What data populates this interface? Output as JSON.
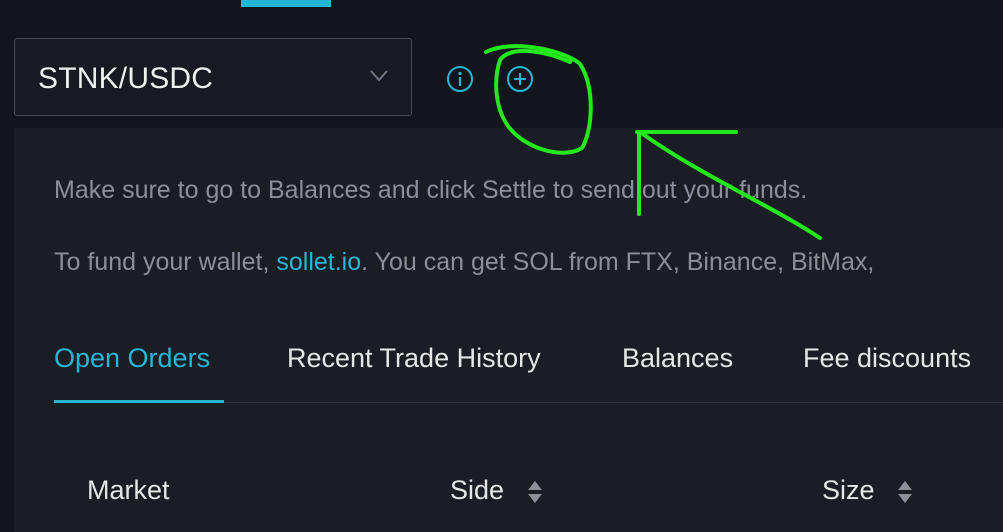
{
  "market": {
    "selected": "STNK/USDC"
  },
  "icons": {
    "info": "info-icon",
    "add_market": "add-market-icon",
    "dropdown": "chevron-down-icon",
    "sort": "sort-icon"
  },
  "notices": {
    "settle": "Make sure to go to Balances and click Settle to send out your funds.",
    "fund_prefix": "To fund your wallet,",
    "fund_link": "sollet.io",
    "fund_suffix": ". You can get SOL from FTX, Binance, BitMax,"
  },
  "tabs": [
    {
      "label": "Open Orders",
      "active": true
    },
    {
      "label": "Recent Trade History",
      "active": false
    },
    {
      "label": "Balances",
      "active": false
    },
    {
      "label": "Fee discounts",
      "active": false
    }
  ],
  "columns": [
    "Market",
    "Side",
    "Size"
  ],
  "colors": {
    "accent": "#26b6d4",
    "annotation": "#22e81c",
    "background": "#13151c",
    "panel": "#1b1d25"
  }
}
